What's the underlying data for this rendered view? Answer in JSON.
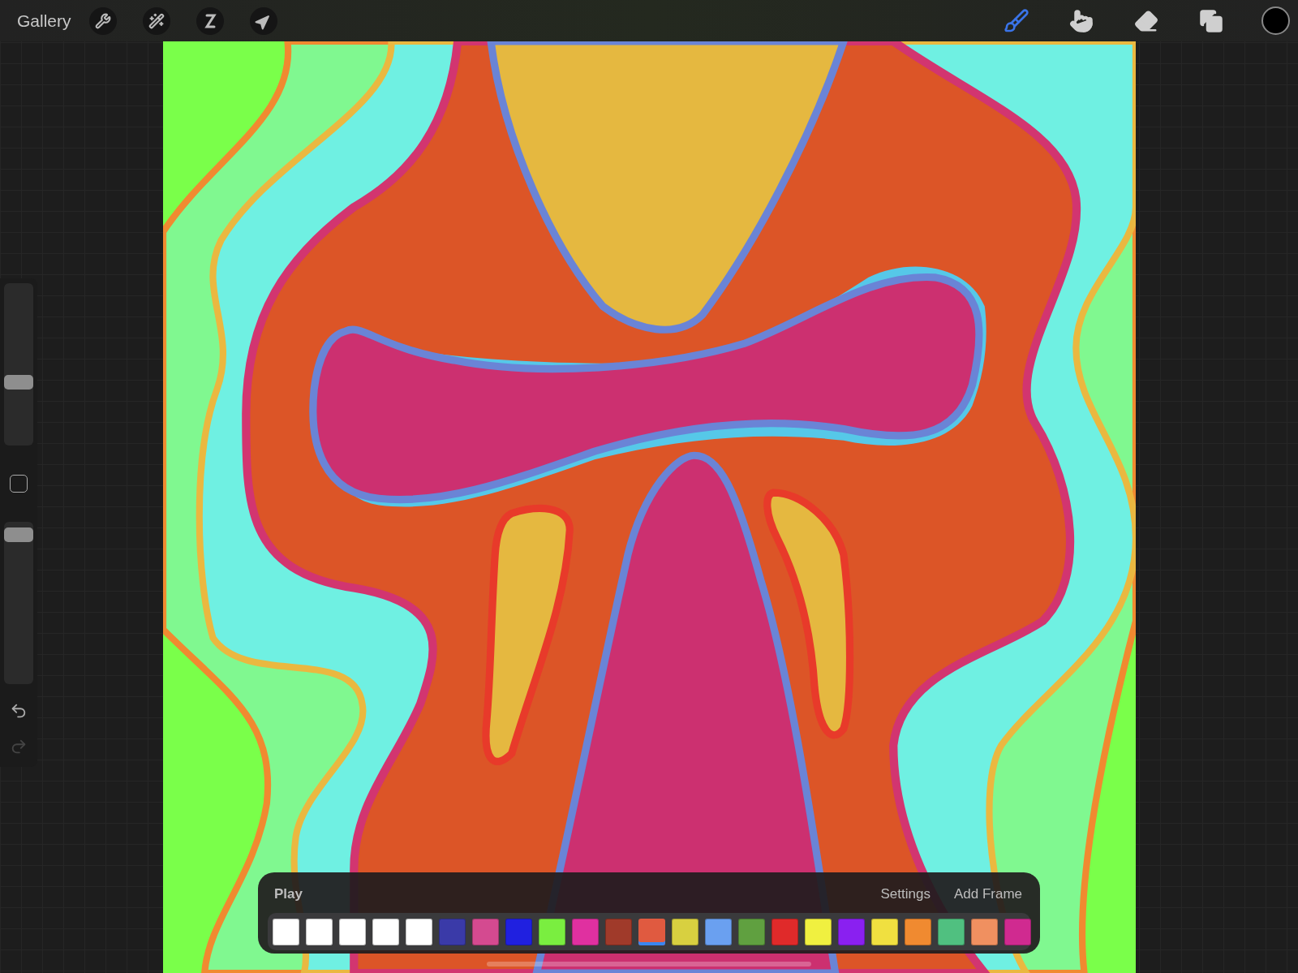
{
  "topbar": {
    "gallery": "Gallery",
    "left_tools": [
      {
        "kind": "wrench"
      },
      {
        "kind": "wand"
      },
      {
        "kind": "selection"
      },
      {
        "kind": "transform"
      }
    ],
    "right_tools": [
      {
        "kind": "brush",
        "selected": true
      },
      {
        "kind": "smudge",
        "selected": false
      },
      {
        "kind": "eraser",
        "selected": false
      },
      {
        "kind": "layers",
        "selected": false
      }
    ],
    "color": "#000000"
  },
  "sidebar": {
    "size": {
      "level": 0.38
    },
    "opacity": {
      "level": 0.96
    }
  },
  "timeline": {
    "play": "Play",
    "settings": "Settings",
    "add_frame": "Add Frame",
    "frames": [
      {
        "color": "#ffffff",
        "selected": false
      },
      {
        "color": "#ffffff",
        "selected": false
      },
      {
        "color": "#ffffff",
        "selected": false
      },
      {
        "color": "#ffffff",
        "selected": false
      },
      {
        "color": "#ffffff",
        "selected": false
      },
      {
        "color": "#3a3aa8",
        "selected": false
      },
      {
        "color": "#d44a90",
        "selected": false
      },
      {
        "color": "#2020e0",
        "selected": false
      },
      {
        "color": "#7aee40",
        "selected": false
      },
      {
        "color": "#e030a0",
        "selected": false
      },
      {
        "color": "#a03a2a",
        "selected": false
      },
      {
        "color": "#e05a40",
        "selected": true
      },
      {
        "color": "#d8d040",
        "selected": false
      },
      {
        "color": "#6aa0f0",
        "selected": false
      },
      {
        "color": "#60a040",
        "selected": false
      },
      {
        "color": "#e02a2a",
        "selected": false
      },
      {
        "color": "#f0f040",
        "selected": false
      },
      {
        "color": "#8a20f0",
        "selected": false
      },
      {
        "color": "#f0e040",
        "selected": false
      },
      {
        "color": "#f08a30",
        "selected": false
      },
      {
        "color": "#50c080",
        "selected": false
      },
      {
        "color": "#f09060",
        "selected": false
      },
      {
        "color": "#d02a90",
        "selected": false
      }
    ]
  }
}
